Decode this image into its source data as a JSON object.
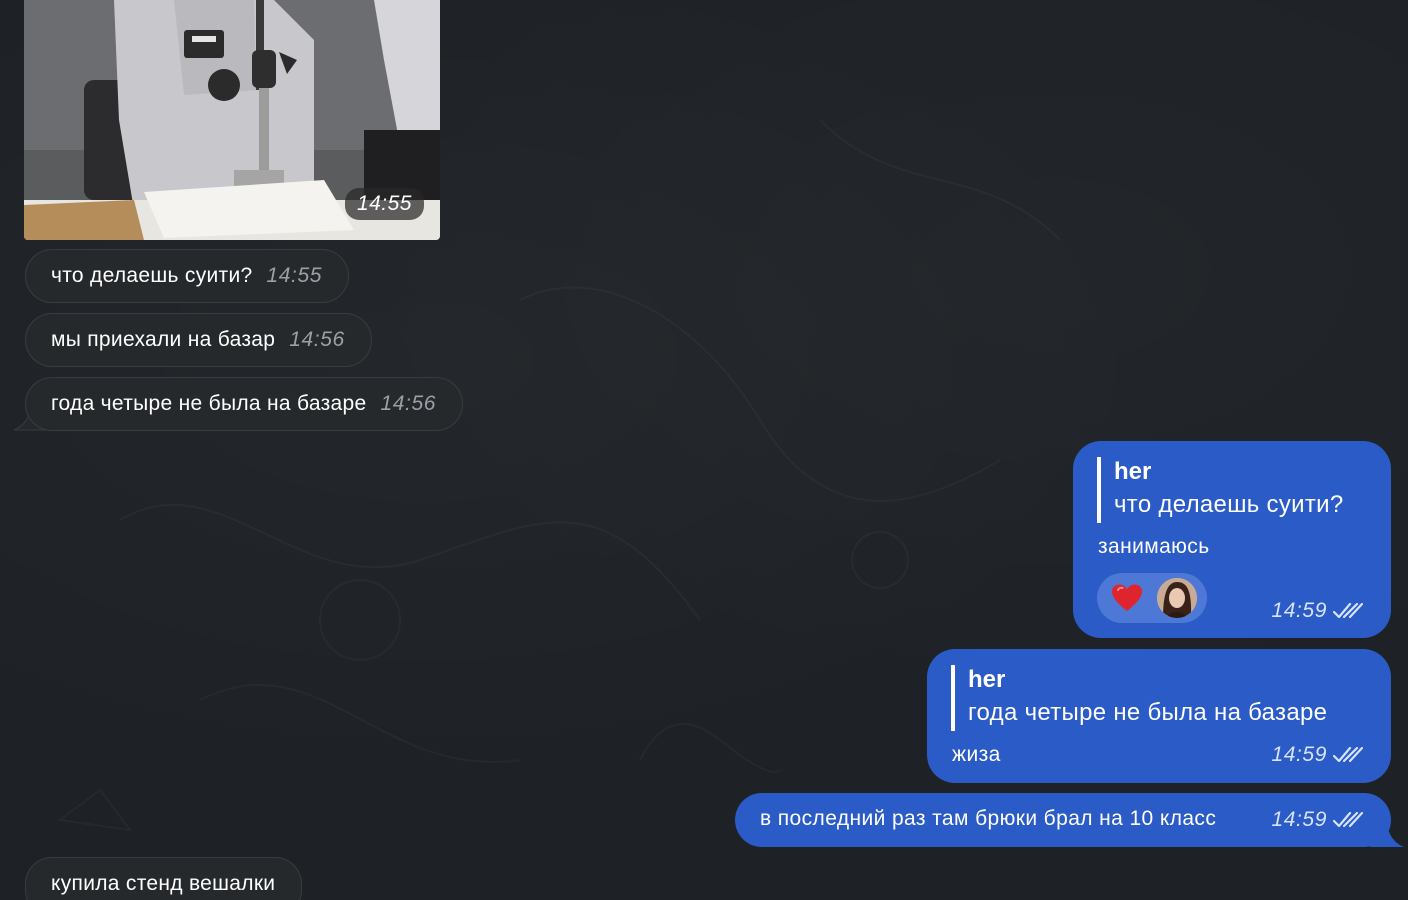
{
  "messages": {
    "photo": {
      "time": "14:55"
    },
    "incoming": [
      {
        "text": "что делаешь суити?",
        "time": "14:55"
      },
      {
        "text": "мы приехали на базар",
        "time": "14:56"
      },
      {
        "text": "года четыре не была на базаре",
        "time": "14:56"
      },
      {
        "text": "купила стенд вешалки",
        "time": ""
      }
    ],
    "outgoing": [
      {
        "reply_author": "her",
        "reply_quote": "что делаешь суити?",
        "text": "занимаюсь",
        "time": "14:59",
        "reactions": {
          "emoji": "heart-icon",
          "reactor": "avatar"
        }
      },
      {
        "reply_author": "her",
        "reply_quote": "года четыре не была на базаре",
        "text": "жиза",
        "time": "14:59"
      },
      {
        "text": "в последний раз там брюки брал на 10 класс",
        "time": "14:59"
      }
    ]
  },
  "colors": {
    "background": "#1e2226",
    "incoming_bubble": "#25292c",
    "outgoing_bubble": "#2a5bc7",
    "heart": "#e0242e"
  }
}
